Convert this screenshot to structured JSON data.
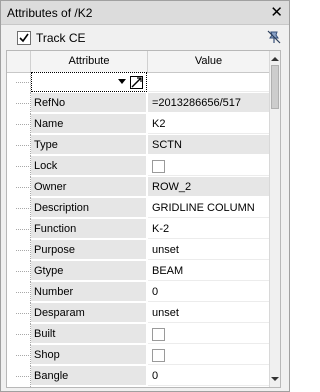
{
  "window": {
    "title": "Attributes of /K2",
    "close_glyph": "✕"
  },
  "toolbar": {
    "track_label": "Track CE",
    "track_checked": true
  },
  "table": {
    "columns": [
      "Attribute",
      "Value"
    ],
    "rows": [
      {
        "attribute": "RefNo",
        "value": "=2013286656/517",
        "shaded": true
      },
      {
        "attribute": "Name",
        "value": "K2",
        "shaded": false
      },
      {
        "attribute": "Type",
        "value": "SCTN",
        "shaded": true
      },
      {
        "attribute": "Lock",
        "value": "",
        "checkbox": true
      },
      {
        "attribute": "Owner",
        "value": "ROW_2",
        "shaded": true
      },
      {
        "attribute": "Description",
        "value": "GRIDLINE COLUMN",
        "shaded": false
      },
      {
        "attribute": "Function",
        "value": "K-2",
        "shaded": false
      },
      {
        "attribute": "Purpose",
        "value": "unset",
        "shaded": false
      },
      {
        "attribute": "Gtype",
        "value": "BEAM",
        "shaded": false
      },
      {
        "attribute": "Number",
        "value": "0",
        "shaded": false
      },
      {
        "attribute": "Desparam",
        "value": "unset",
        "shaded": false
      },
      {
        "attribute": "Built",
        "value": "",
        "checkbox": true
      },
      {
        "attribute": "Shop",
        "value": "",
        "checkbox": true
      },
      {
        "attribute": "Bangle",
        "value": "0",
        "shaded": false
      }
    ]
  }
}
